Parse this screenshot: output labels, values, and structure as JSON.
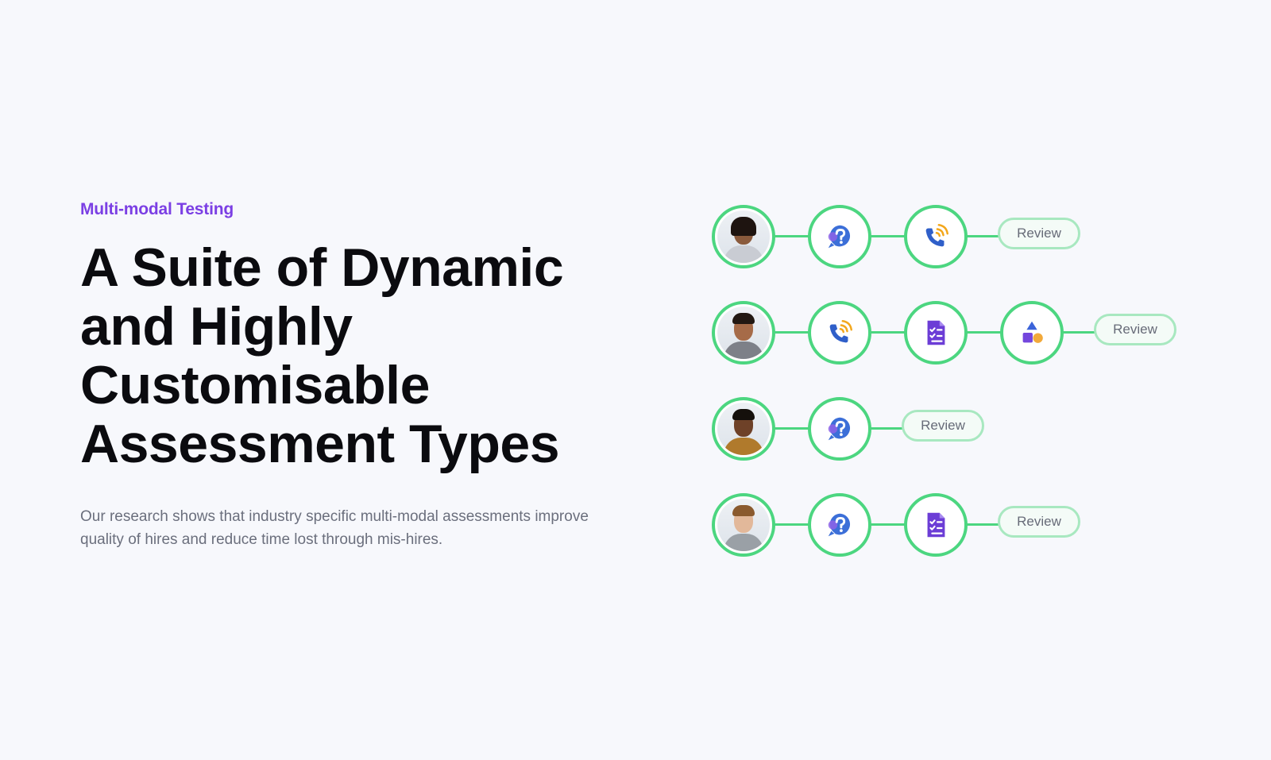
{
  "eyebrow": "Multi-modal Testing",
  "headline": [
    "A Suite of Dynamic",
    "and Highly",
    "Customisable",
    "Assessment Types"
  ],
  "description": "Our research shows that industry specific multi-modal assessments improve quality of hires and reduce time lost through mis-hires.",
  "colors": {
    "accent": "#7b3fe4",
    "connector": "#4cd680",
    "review_border": "#a8e8c0",
    "text_dark": "#0b0b0f",
    "text_muted": "#6b6f7d"
  },
  "flows": [
    {
      "candidate": "candidate-1",
      "steps": [
        "question-icon",
        "phone-call-icon"
      ],
      "review_label": "Review"
    },
    {
      "candidate": "candidate-2",
      "steps": [
        "phone-call-icon",
        "checklist-icon",
        "shapes-icon"
      ],
      "review_label": "Review"
    },
    {
      "candidate": "candidate-3",
      "steps": [
        "question-icon"
      ],
      "review_label": "Review"
    },
    {
      "candidate": "candidate-4",
      "steps": [
        "question-icon",
        "checklist-icon"
      ],
      "review_label": "Review"
    }
  ]
}
